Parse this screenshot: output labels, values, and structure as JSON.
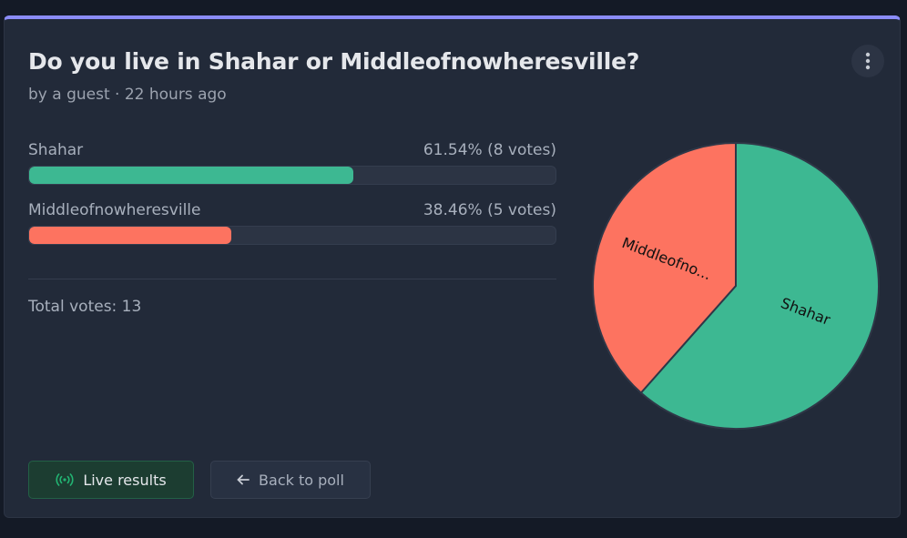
{
  "poll": {
    "title": "Do you live in Shahar or Middleofnowheresville?",
    "meta": "by a guest · 22 hours ago",
    "menu_icon": "more-vertical-icon",
    "options": [
      {
        "label": "Shahar",
        "result": "61.54% (8 votes)",
        "percent": 61.54,
        "votes": 8,
        "color": "#3db892"
      },
      {
        "label": "Middleofnowheresville",
        "result": "38.46% (5 votes)",
        "percent": 38.46,
        "votes": 5,
        "color": "#fd7360"
      }
    ],
    "total": "Total votes: 13"
  },
  "buttons": {
    "live_label": "Live results",
    "live_icon": "broadcast-icon",
    "back_label": "Back to poll",
    "back_icon": "arrow-left-icon"
  },
  "chart_data": {
    "type": "pie",
    "categories": [
      "Shahar",
      "Middleofnowheresville"
    ],
    "values": [
      8,
      5
    ],
    "slice_labels": [
      "Shahar",
      "Middleofno..."
    ],
    "colors": [
      "#3db892",
      "#fd7360"
    ]
  }
}
